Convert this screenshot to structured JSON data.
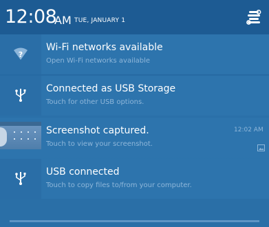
{
  "header": {
    "time": "12:08",
    "ampm": "AM",
    "date": "TUE, JANUARY 1",
    "settings_icon": "settings-icon"
  },
  "notifications": [
    {
      "icon": "wifi-question-icon",
      "title": "Wi-Fi networks available",
      "subtitle": "Open Wi-Fi networks available"
    },
    {
      "icon": "usb-icon",
      "title": "Connected as USB Storage",
      "subtitle": "Touch for other USB options."
    },
    {
      "icon": "screenshot-thumbnail",
      "title": "Screenshot captured.",
      "subtitle": "Touch to view your screenshot.",
      "time": "12:02 AM",
      "small_icon": "image-icon"
    },
    {
      "icon": "usb-icon",
      "title": "USB connected",
      "subtitle": "Touch to copy files to/from your computer."
    }
  ],
  "colors": {
    "accent": "#2d74ad",
    "subtitle": "#8fb7da"
  }
}
